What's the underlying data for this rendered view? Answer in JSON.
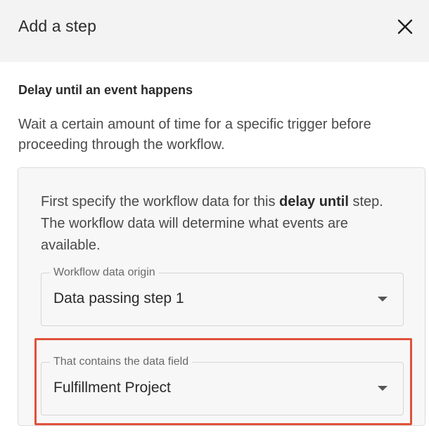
{
  "header": {
    "title": "Add a step",
    "close_icon": "close-icon"
  },
  "section": {
    "title": "Delay until an event happens",
    "description": "Wait a certain amount of time for a specific trigger before proceeding through the workflow."
  },
  "panel": {
    "intro_before": "First specify the workflow data for this ",
    "intro_bold": "delay until",
    "intro_after": " step. The workflow data will determine what events are available."
  },
  "fields": {
    "origin": {
      "label": "Workflow data origin",
      "value": "Data passing step 1",
      "icon": "dropdown-arrow-icon"
    },
    "data_field": {
      "label": "That contains the data field",
      "value": "Fulfillment Project",
      "icon": "dropdown-arrow-icon"
    }
  },
  "colors": {
    "header_bg": "#f3f3f3",
    "panel_bg": "#f7f7f7",
    "highlight": "#e0513a"
  }
}
